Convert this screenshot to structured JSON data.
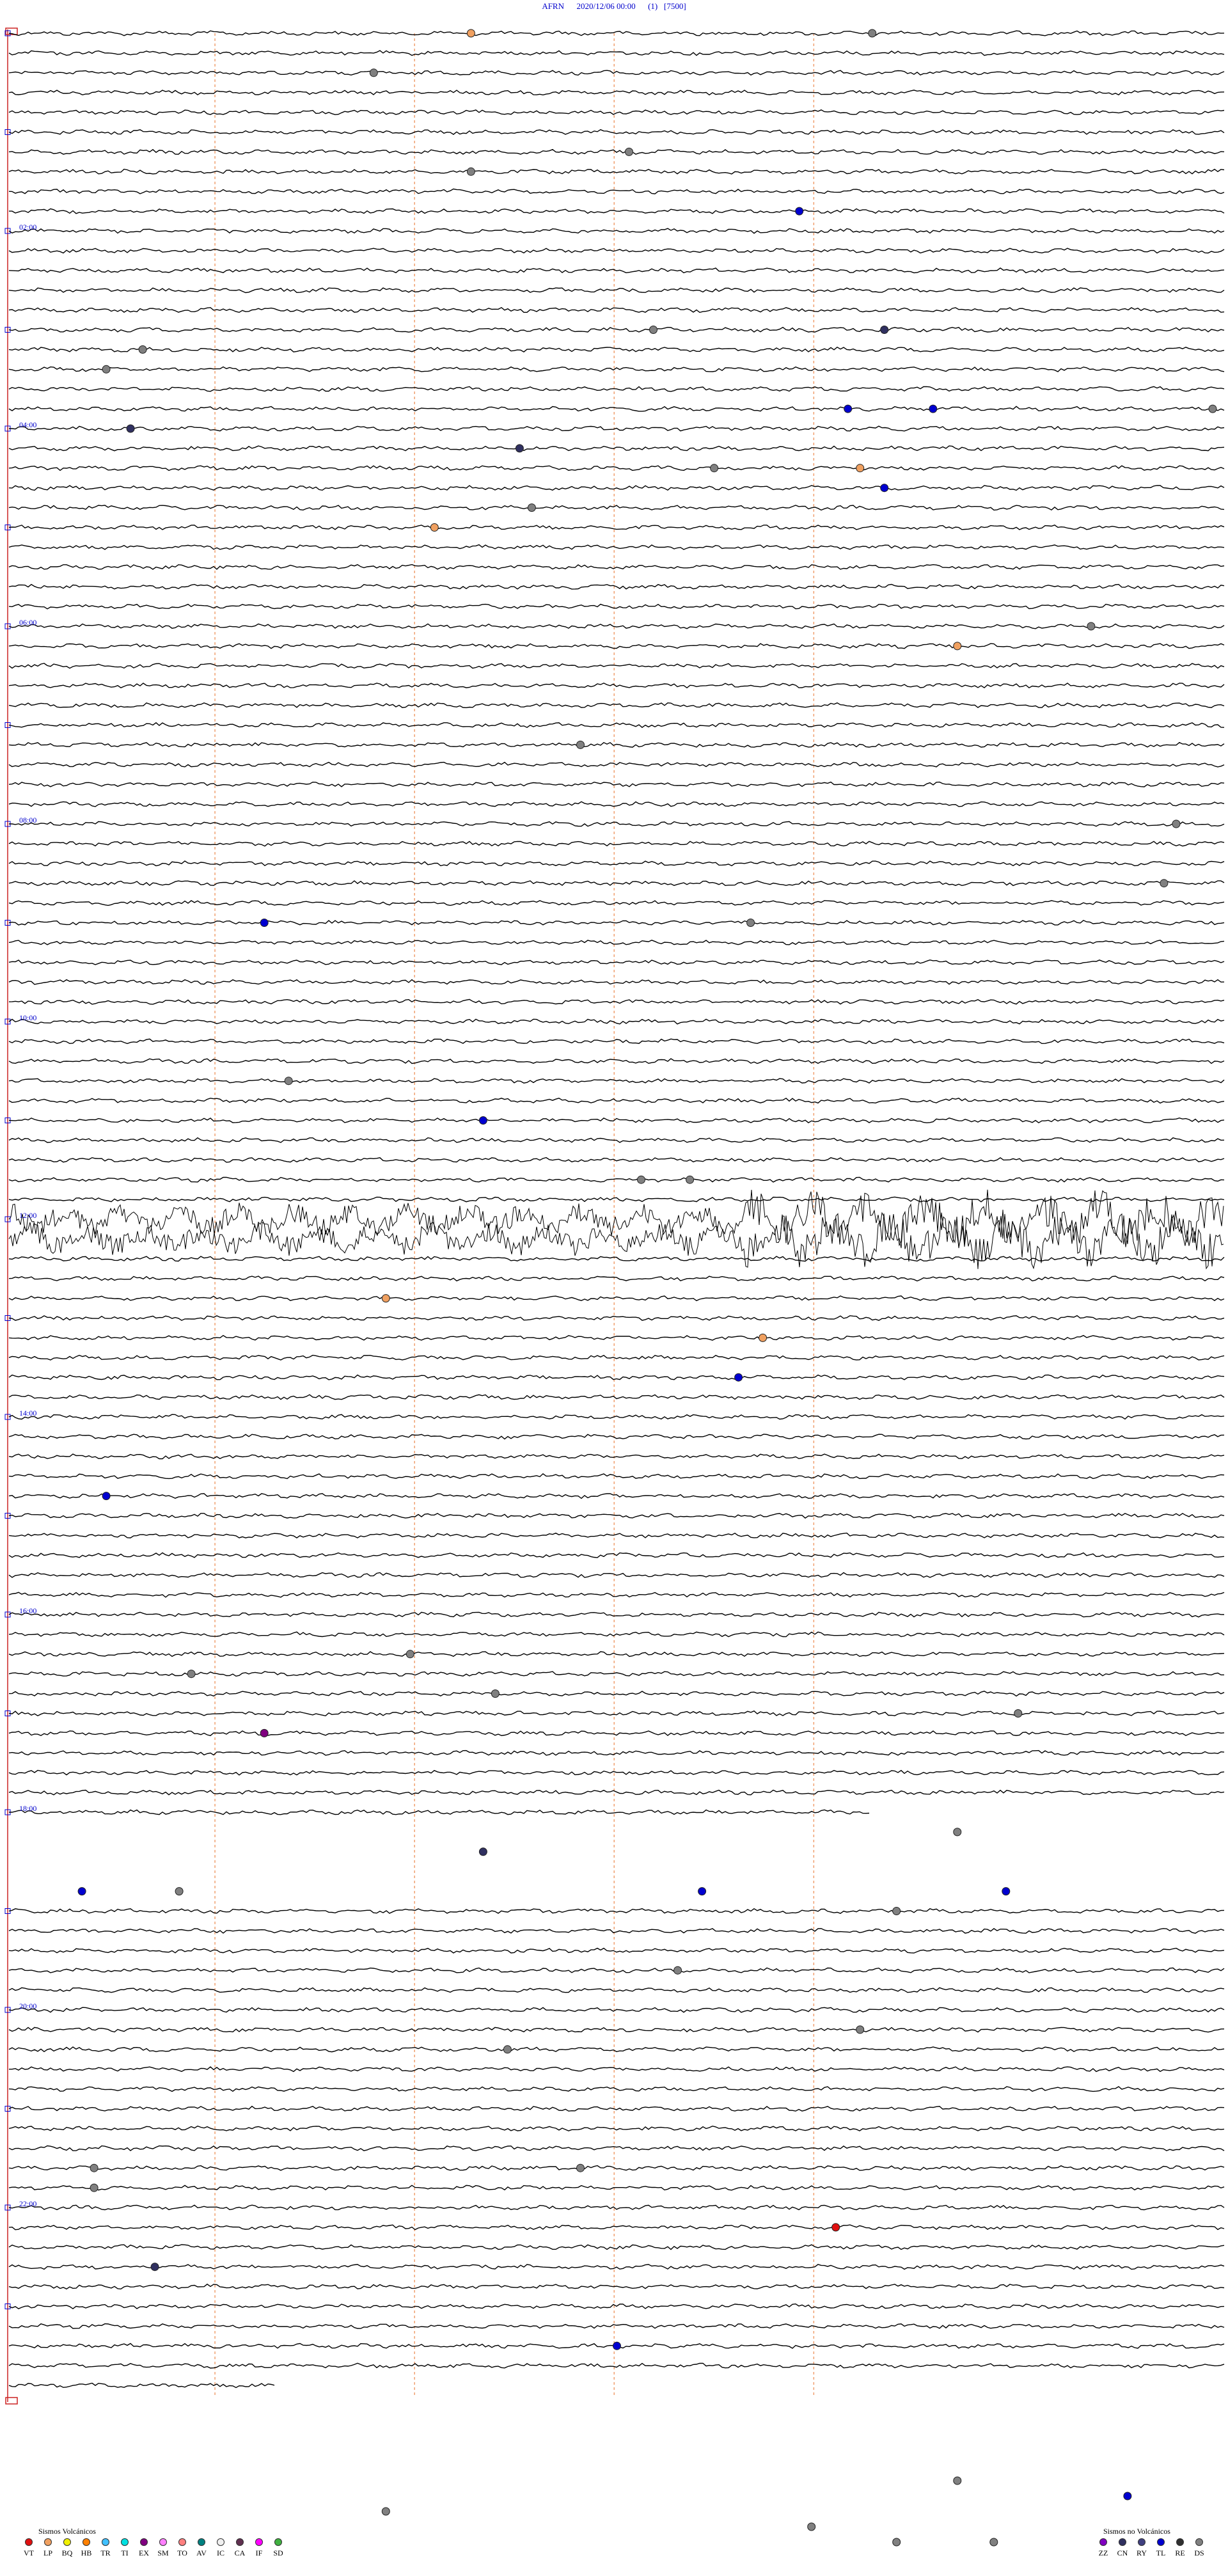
{
  "header": {
    "station": "AFRN",
    "datetime": "2020/12/06 00:00",
    "channel": "(1)",
    "scale": "[7500]"
  },
  "chart_data": {
    "type": "seismogram-helicorder",
    "rows": 120,
    "minutes_per_row": 12,
    "hour_labels": [
      "02:00",
      "04:00",
      "06:00",
      "08:00",
      "10:00",
      "12:00",
      "14:00",
      "16:00",
      "18:00",
      "20:00",
      "22:00"
    ],
    "hour_label_rows": [
      10,
      20,
      30,
      40,
      50,
      60,
      70,
      80,
      90,
      100,
      110
    ],
    "minute_markers": [
      2,
      4,
      6,
      8
    ],
    "gap_rows": [
      91,
      92,
      93,
      94
    ],
    "noisy_rows": [
      60,
      61
    ],
    "events": [
      {
        "row": 0,
        "t": 0.38,
        "type": "LP"
      },
      {
        "row": 0,
        "t": 0.71,
        "type": "DS"
      },
      {
        "row": 2,
        "t": 0.3,
        "type": "DS"
      },
      {
        "row": 6,
        "t": 0.51,
        "type": "DS"
      },
      {
        "row": 7,
        "t": 0.38,
        "type": "DS"
      },
      {
        "row": 9,
        "t": 0.65,
        "type": "TL"
      },
      {
        "row": 15,
        "t": 0.53,
        "type": "DS"
      },
      {
        "row": 15,
        "t": 0.72,
        "type": "CN"
      },
      {
        "row": 16,
        "t": 0.11,
        "type": "DS"
      },
      {
        "row": 17,
        "t": 0.08,
        "type": "DS"
      },
      {
        "row": 19,
        "t": 0.69,
        "type": "TL"
      },
      {
        "row": 19,
        "t": 0.76,
        "type": "TL"
      },
      {
        "row": 19,
        "t": 0.99,
        "type": "DS"
      },
      {
        "row": 20,
        "t": 0.1,
        "type": "CN"
      },
      {
        "row": 21,
        "t": 0.42,
        "type": "CN"
      },
      {
        "row": 22,
        "t": 0.7,
        "type": "LP"
      },
      {
        "row": 22,
        "t": 0.58,
        "type": "DS"
      },
      {
        "row": 23,
        "t": 0.72,
        "type": "TL"
      },
      {
        "row": 24,
        "t": 0.43,
        "type": "DS"
      },
      {
        "row": 25,
        "t": 0.35,
        "type": "LP"
      },
      {
        "row": 30,
        "t": 0.89,
        "type": "DS"
      },
      {
        "row": 31,
        "t": 0.78,
        "type": "LP"
      },
      {
        "row": 36,
        "t": 0.47,
        "type": "DS"
      },
      {
        "row": 40,
        "t": 0.96,
        "type": "DS"
      },
      {
        "row": 43,
        "t": 0.95,
        "type": "DS"
      },
      {
        "row": 45,
        "t": 0.21,
        "type": "TL"
      },
      {
        "row": 45,
        "t": 0.61,
        "type": "DS"
      },
      {
        "row": 53,
        "t": 0.23,
        "type": "DS"
      },
      {
        "row": 55,
        "t": 0.39,
        "type": "TL"
      },
      {
        "row": 58,
        "t": 0.56,
        "type": "DS"
      },
      {
        "row": 58,
        "t": 0.52,
        "type": "DS"
      },
      {
        "row": 64,
        "t": 0.31,
        "type": "LP"
      },
      {
        "row": 66,
        "t": 0.62,
        "type": "LP"
      },
      {
        "row": 68,
        "t": 0.6,
        "type": "TL"
      },
      {
        "row": 74,
        "t": 0.08,
        "type": "TL"
      },
      {
        "row": 83,
        "t": 0.15,
        "type": "DS"
      },
      {
        "row": 82,
        "t": 0.33,
        "type": "DS"
      },
      {
        "row": 84,
        "t": 0.4,
        "type": "DS"
      },
      {
        "row": 85,
        "t": 0.83,
        "type": "DS"
      },
      {
        "row": 86,
        "t": 0.21,
        "type": "EX"
      },
      {
        "row": 91,
        "t": 0.78,
        "type": "DS"
      },
      {
        "row": 92,
        "t": 0.39,
        "type": "CN"
      },
      {
        "row": 94,
        "t": 0.06,
        "type": "TL"
      },
      {
        "row": 94,
        "t": 0.14,
        "type": "DS"
      },
      {
        "row": 94,
        "t": 0.57,
        "type": "TL"
      },
      {
        "row": 94,
        "t": 0.82,
        "type": "TL"
      },
      {
        "row": 95,
        "t": 0.73,
        "type": "DS"
      },
      {
        "row": 98,
        "t": 0.55,
        "type": "DS"
      },
      {
        "row": 101,
        "t": 0.7,
        "type": "DS"
      },
      {
        "row": 102,
        "t": 0.41,
        "type": "DS"
      },
      {
        "row": 108,
        "t": 0.07,
        "type": "DS"
      },
      {
        "row": 108,
        "t": 0.47,
        "type": "DS"
      },
      {
        "row": 109,
        "t": 0.07,
        "type": "DS"
      },
      {
        "row": 111,
        "t": 0.68,
        "type": "VT"
      },
      {
        "row": 113,
        "t": 0.12,
        "type": "CN"
      },
      {
        "row": 117,
        "t": 0.5,
        "type": "TL"
      }
    ],
    "extra_markers": [
      {
        "t": 0.78,
        "type": "DS",
        "level": 0
      },
      {
        "t": 0.92,
        "type": "TL",
        "level": 1
      },
      {
        "t": 0.31,
        "type": "DS",
        "level": 2
      },
      {
        "t": 0.66,
        "type": "DS",
        "level": 3
      },
      {
        "t": 0.73,
        "type": "DS",
        "level": 4
      },
      {
        "t": 0.81,
        "type": "DS",
        "level": 4
      }
    ],
    "type_colors": {
      "VT": "#e01010",
      "LP": "#f0a060",
      "BQ": "#f0f000",
      "HB": "#ff8000",
      "TR": "#40c0ff",
      "TI": "#00e0e0",
      "EX": "#800080",
      "SM": "#ff80ff",
      "TO": "#ff8080",
      "AV": "#008080",
      "IC": "#f0f0f0",
      "CA": "#603050",
      "IF": "#ff00ff",
      "SD": "#40b040",
      "ZZ": "#8000c0",
      "CN": "#303060",
      "RY": "#404080",
      "TL": "#0000d0",
      "RE": "#303030",
      "DS": "#808080"
    }
  },
  "legend_volcanic": {
    "title": "Sismos Volcánicos",
    "items": [
      {
        "code": "VT"
      },
      {
        "code": "LP"
      },
      {
        "code": "BQ"
      },
      {
        "code": "HB"
      },
      {
        "code": "TR"
      },
      {
        "code": "TI"
      },
      {
        "code": "EX"
      },
      {
        "code": "SM"
      },
      {
        "code": "TO"
      },
      {
        "code": "AV"
      },
      {
        "code": "IC"
      },
      {
        "code": "CA"
      },
      {
        "code": "IF"
      },
      {
        "code": "SD"
      }
    ]
  },
  "legend_nonvolcanic": {
    "title": "Sismos no Volcánicos",
    "items": [
      {
        "code": "ZZ"
      },
      {
        "code": "CN"
      },
      {
        "code": "RY"
      },
      {
        "code": "TL"
      },
      {
        "code": "RE"
      },
      {
        "code": "DS"
      }
    ]
  }
}
